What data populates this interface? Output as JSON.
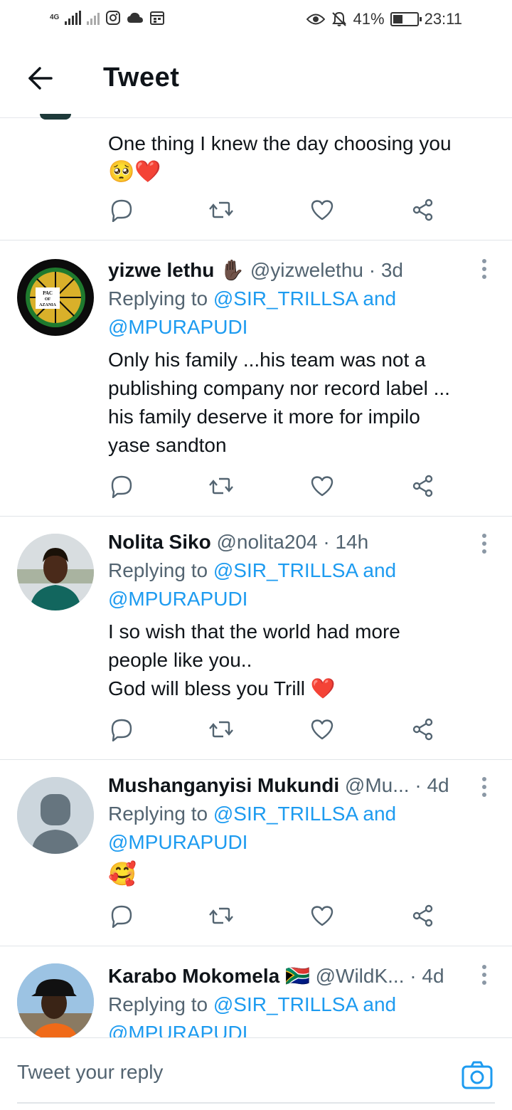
{
  "status_bar": {
    "network": "4G",
    "battery": "41%",
    "battery_level": 0.41,
    "time": "23:11"
  },
  "header": {
    "title": "Tweet"
  },
  "tweets": [
    {
      "text_lines": [
        "One thing I knew the day choosing you"
      ],
      "emojis": "🥺❤️"
    },
    {
      "name": "yizwe lethu",
      "emoji": "✋🏿",
      "handle": "@yizwelethu",
      "time": "· 3d",
      "reply_prefix": "Replying to ",
      "reply_mention1": "@SIR_TRILLSA",
      "reply_and": " and",
      "reply_mention2": "@MPURAPUDI",
      "text_lines": [
        "Only his family ...his team was not a",
        "publishing company nor record label ...",
        "his family deserve it more for impilo",
        "yase sandton"
      ],
      "avatar_text": [
        "PAC",
        "OF",
        "AZANIA"
      ]
    },
    {
      "name": "Nolita Siko",
      "handle": "@nolita204",
      "time": "· 14h",
      "reply_prefix": "Replying to ",
      "reply_mention1": "@SIR_TRILLSA",
      "reply_and": " and",
      "reply_mention2": "@MPURAPUDI",
      "text_lines": [
        "I so wish that the world had more",
        "people like you..",
        "God will bless you Trill"
      ],
      "emoji": "❤️"
    },
    {
      "name": "Mushanganyisi Mukundi",
      "handle": "@Mu...",
      "time": "· 4d",
      "reply_prefix": "Replying to ",
      "reply_mention1": "@SIR_TRILLSA",
      "reply_and": " and",
      "reply_mention2": "@MPURAPUDI",
      "emoji": "🥰"
    },
    {
      "name": "Karabo Mokomela",
      "emoji": "🇿🇦",
      "handle": "@WildK...",
      "time": "· 4d",
      "reply_prefix": "Replying to ",
      "reply_mention1": "@SIR_TRILLSA",
      "reply_and": " and",
      "reply_mention2": "@MPURAPUDI"
    }
  ],
  "reply_bar": {
    "placeholder": "Tweet your reply"
  },
  "icons": [
    "back-arrow-icon",
    "reply-icon",
    "retweet-icon",
    "like-icon",
    "share-icon",
    "camera-icon",
    "more-icon"
  ],
  "colors": {
    "link": "#1d9bf0",
    "muted": "#536471",
    "heart": "#e0245e"
  }
}
